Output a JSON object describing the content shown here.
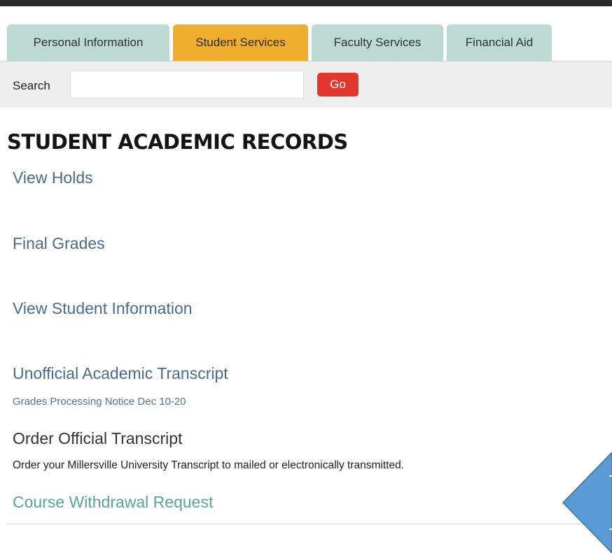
{
  "tabs": [
    {
      "label": "Personal Information"
    },
    {
      "label": "Student Services",
      "active": true
    },
    {
      "label": "Faculty Services"
    },
    {
      "label": "Financial Aid"
    }
  ],
  "search": {
    "label": "Search",
    "value": "",
    "placeholder": "",
    "go_label": "Go"
  },
  "main": {
    "title": "STUDENT ACADEMIC RECORDS",
    "links": {
      "holds": "View Holds",
      "grades": "Final Grades",
      "student_info": "View Student Information",
      "transcript": "Unofficial Academic Transcript",
      "grades_notice": "Grades Processing Notice Dec 10-20",
      "order": "Order Official Transcript",
      "order_desc": "Order your Millersville University Transcript to mailed or electronically transmitted.",
      "withdrawal": "Course Withdrawal Request"
    }
  },
  "colors": {
    "tab_active": "#f0ae2e",
    "tab_inactive": "#bcd9d4",
    "go_button": "#e2372f",
    "link": "#4a6b8a",
    "withdrawal_link": "#56a59c",
    "arrow": "#5b9bd5"
  },
  "icons": {
    "pointer": "left-arrow-icon"
  }
}
